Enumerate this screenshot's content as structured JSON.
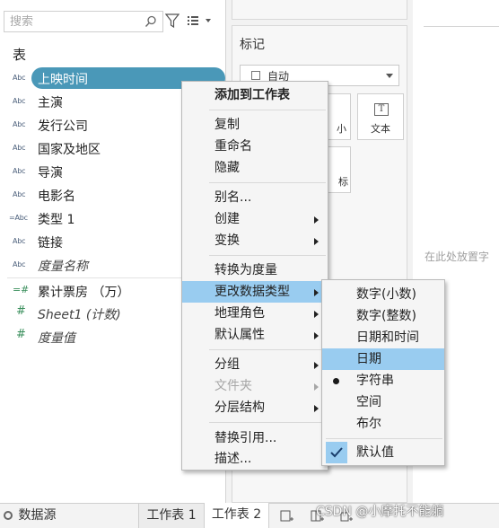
{
  "data_pane": {
    "search_placeholder": "搜索",
    "table_title": "表",
    "fields": [
      {
        "type": "Abc",
        "label": "上映时间"
      },
      {
        "type": "Abc",
        "label": "主演"
      },
      {
        "type": "Abc",
        "label": "发行公司"
      },
      {
        "type": "Abc",
        "label": "国家及地区"
      },
      {
        "type": "Abc",
        "label": "导演"
      },
      {
        "type": "Abc",
        "label": "电影名"
      },
      {
        "type": "=Abc",
        "label": "类型 1"
      },
      {
        "type": "Abc",
        "label": "链接"
      },
      {
        "type": "Abc",
        "label": "度量名称"
      }
    ],
    "measures": [
      {
        "type": "=#",
        "label": "累计票房 （万）"
      },
      {
        "type": "#",
        "label": "Sheet1 (计数)"
      },
      {
        "type": "#",
        "label": "度量值"
      }
    ]
  },
  "marks_card": {
    "title": "标记",
    "mark_type": "自动",
    "text_label": "文本",
    "partial_label_1": "小",
    "partial_label_2": "标"
  },
  "canvas": {
    "drop_hint": "在此处放置字"
  },
  "context_menu": {
    "groups": [
      [
        "添加到工作表"
      ],
      [
        "复制",
        "重命名",
        "隐藏"
      ],
      [
        "别名...",
        "创建",
        "变换"
      ],
      [
        "转换为度量",
        "更改数据类型",
        "地理角色",
        "默认属性"
      ],
      [
        "分组",
        "文件夹",
        "分层结构"
      ],
      [
        "替换引用...",
        "描述..."
      ]
    ]
  },
  "type_submenu": {
    "items": [
      "数字(小数)",
      "数字(整数)",
      "日期和时间",
      "日期",
      "字符串",
      "空间",
      "布尔"
    ],
    "default_label": "默认值"
  },
  "tabs": {
    "datasource": "数据源",
    "sheet1": "工作表 1",
    "sheet2": "工作表 2"
  },
  "watermark": "CSDN @小摩托不能躺",
  "colors": {
    "selected_pill": "#4a98b8",
    "menu_highlight": "#99ccf0"
  }
}
